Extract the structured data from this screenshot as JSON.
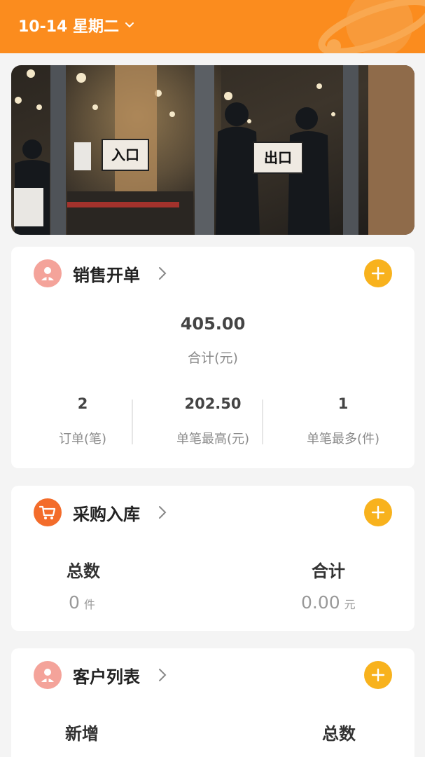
{
  "header": {
    "date_label": "10-14 星期二"
  },
  "banner": {
    "sign_left": "入口",
    "sign_right": "出口"
  },
  "sales": {
    "title": "销售开单",
    "total_value": "405.00",
    "total_label": "合计(元)",
    "stats": [
      {
        "value": "2",
        "label": "订单(笔)"
      },
      {
        "value": "202.50",
        "label": "单笔最高(元)"
      },
      {
        "value": "1",
        "label": "单笔最多(件)"
      }
    ]
  },
  "purchase": {
    "title": "采购入库",
    "count_title": "总数",
    "count_value": "0",
    "count_unit": "件",
    "sum_title": "合计",
    "sum_value": "0.00",
    "sum_unit": "元"
  },
  "customers": {
    "title": "客户列表",
    "new_title": "新增",
    "total_title": "总数"
  },
  "colors": {
    "brand_orange": "#fb8c1e",
    "add_yellow": "#f8b21d",
    "icon_pink": "#f4a39a",
    "icon_orange": "#f36c2b"
  }
}
